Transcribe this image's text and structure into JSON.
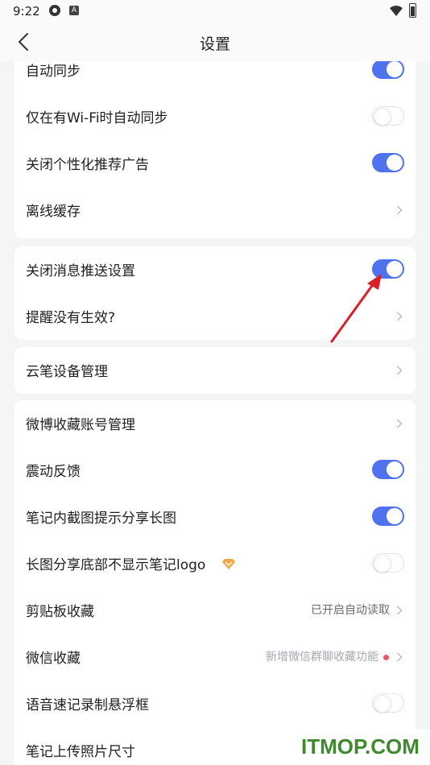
{
  "status_bar": {
    "time": "9:22"
  },
  "nav": {
    "title": "设置"
  },
  "card1": {
    "items": [
      {
        "label": "自动同步",
        "type": "toggle",
        "on": true
      },
      {
        "label": "仅在有Wi-Fi时自动同步",
        "type": "toggle",
        "on": false
      },
      {
        "label": "关闭个性化推荐广告",
        "type": "toggle",
        "on": true
      },
      {
        "label": "离线缓存",
        "type": "link"
      }
    ]
  },
  "card2": {
    "items": [
      {
        "label": "关闭消息推送设置",
        "type": "toggle",
        "on": true
      },
      {
        "label": "提醒没有生效?",
        "type": "link"
      }
    ]
  },
  "card3": {
    "items": [
      {
        "label": "云笔设备管理",
        "type": "link"
      }
    ]
  },
  "card4": {
    "items": [
      {
        "label": "微博收藏账号管理",
        "type": "link"
      },
      {
        "label": "震动反馈",
        "type": "toggle",
        "on": true
      },
      {
        "label": "笔记内截图提示分享长图",
        "type": "toggle",
        "on": true
      },
      {
        "label": "长图分享底部不显示笔记logo",
        "type": "toggle",
        "on": false,
        "badge": "vip-diamond-icon"
      },
      {
        "label": "剪贴板收藏",
        "type": "link",
        "value": "已开启自动读取"
      },
      {
        "label": "微信收藏",
        "type": "link",
        "value": "新增微信群聊收藏功能",
        "dot": true
      },
      {
        "label": "语音速记录制悬浮框",
        "type": "toggle",
        "on": false
      },
      {
        "label": "笔记上传照片尺寸",
        "type": "link"
      }
    ]
  },
  "watermark": {
    "text": "ITMOP.COM"
  },
  "colors": {
    "accent": "#4f73ee",
    "arrow": "#d9202a",
    "watermark": "#3f8a2e",
    "dot": "#f0566b"
  }
}
